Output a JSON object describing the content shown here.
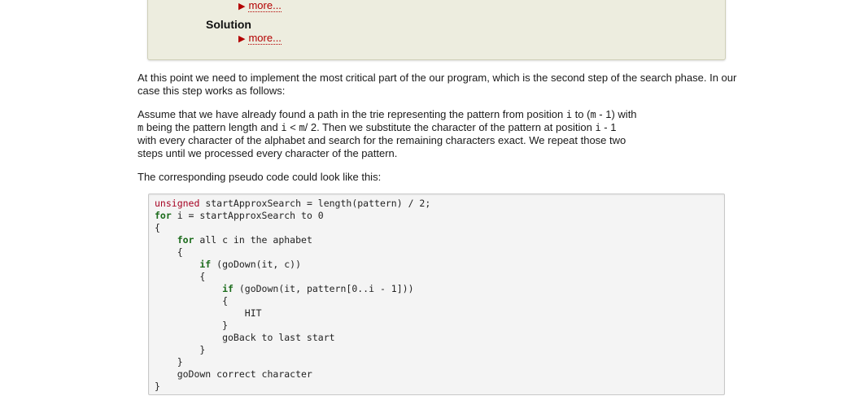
{
  "hint_box": {
    "more_label_1": "more...",
    "solution_label": "Solution",
    "more_label_2": "more..."
  },
  "paragraphs": {
    "p1": "At this point we need to implement the most critical part of the our program, which is the second step of the search phase. In our case this step works as follows:",
    "p2_line1_a": "Assume that we have already found a path in the trie representing the pattern from position ",
    "p2_i": "i",
    "p2_line1_b": " to (",
    "p2_m1": "m",
    "p2_line1_c": " - 1) with",
    "p2_line2_a": "m",
    "p2_line2_b": " being the pattern length and ",
    "p2_i2": "i",
    "p2_line2_c": " < ",
    "p2_m2": "m",
    "p2_line2_d": "/ 2. Then we substitute the character of the pattern at position ",
    "p2_i3": "i",
    "p2_line2_e": " - 1",
    "p2_line3": "with every character of the alphabet and search for the remaining characters exact. We repeat those two",
    "p2_line4": "steps until we processed every character of the pattern.",
    "p3": "The corresponding pseudo code could look like this:"
  },
  "code": {
    "l1_kw": "unsigned",
    "l1_rest": " startApproxSearch = length(pattern) / 2;",
    "l2_kw": "for",
    "l2_rest": " i = startApproxSearch to 0",
    "l3": "{",
    "l4_kw": "    for",
    "l4_rest": " all c in the aphabet",
    "l5": "    {",
    "l6_kw": "        if",
    "l6_rest": " (goDown(it, c))",
    "l7": "        {",
    "l8_kw": "            if",
    "l8_rest": " (goDown(it, pattern[0..i - 1]))",
    "l9": "            {",
    "l10": "                HIT",
    "l11": "            }",
    "l12": "            goBack to last start",
    "l13": "        }",
    "l14": "    }",
    "l15": "    goDown correct character",
    "l16": "}"
  }
}
